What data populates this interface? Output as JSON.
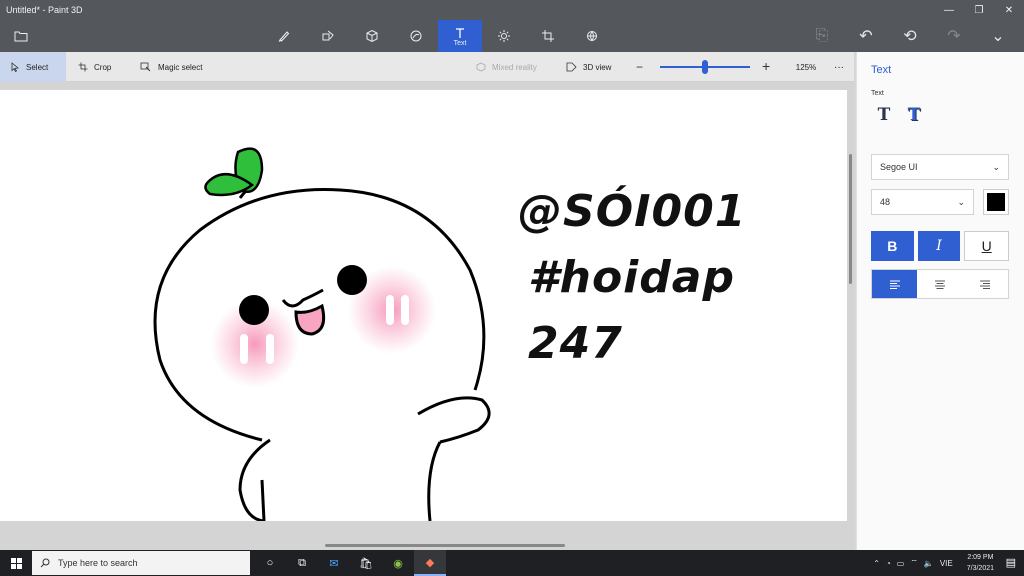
{
  "window": {
    "title": "Untitled* - Paint 3D",
    "controls": {
      "minimize": "—",
      "maximize": "❐",
      "close": "✕"
    }
  },
  "toolbar": {
    "menu_icon": "folder-icon",
    "tools": [
      {
        "name": "brushes",
        "label": "",
        "icon": "brush-icon"
      },
      {
        "name": "2d-shapes",
        "label": "",
        "icon": "shapes-2d-icon"
      },
      {
        "name": "3d-shapes",
        "label": "",
        "icon": "cube-icon"
      },
      {
        "name": "stickers",
        "label": "",
        "icon": "sticker-icon"
      },
      {
        "name": "text",
        "label": "Text",
        "icon": "text-t-icon",
        "active": true
      },
      {
        "name": "effects",
        "label": "",
        "icon": "sun-icon"
      },
      {
        "name": "canvas",
        "label": "",
        "icon": "crop-canvas-icon"
      },
      {
        "name": "3d-library",
        "label": "",
        "icon": "library-icon"
      }
    ],
    "right_actions": [
      {
        "name": "paste",
        "icon": "paste-icon",
        "glyph": "⎘",
        "disabled": true
      },
      {
        "name": "undo",
        "icon": "undo-icon",
        "glyph": "↶"
      },
      {
        "name": "history",
        "icon": "history-icon",
        "glyph": "⟲"
      },
      {
        "name": "redo",
        "icon": "redo-icon",
        "glyph": "↷",
        "disabled": true
      },
      {
        "name": "expand",
        "icon": "chevron-down-icon",
        "glyph": "⌄"
      }
    ]
  },
  "subtoolbar": {
    "select_label": "Select",
    "crop_label": "Crop",
    "magic_select_label": "Magic select",
    "mixed_reality_label": "Mixed reality",
    "view3d_label": "3D view",
    "zoom_level": 0.5,
    "zoom_label": "125%",
    "more_label": "···"
  },
  "canvas": {
    "text_lines": [
      "@SÓI001",
      "#hoidap",
      "247"
    ]
  },
  "panel": {
    "title": "Text",
    "section_label": "Text",
    "font_value": "Segoe UI",
    "size_value": "48",
    "text_color": "#000000",
    "bold_label": "B",
    "italic_label": "I",
    "underline_label": "U"
  },
  "taskbar": {
    "search_placeholder": "Type here to search",
    "language": "VIE",
    "time": "2:09 PM",
    "date": "7/3/2021"
  },
  "colors": {
    "accent": "#2f5fd0",
    "sprout": "#2fbf3a",
    "blush": "#f8a5c2"
  }
}
